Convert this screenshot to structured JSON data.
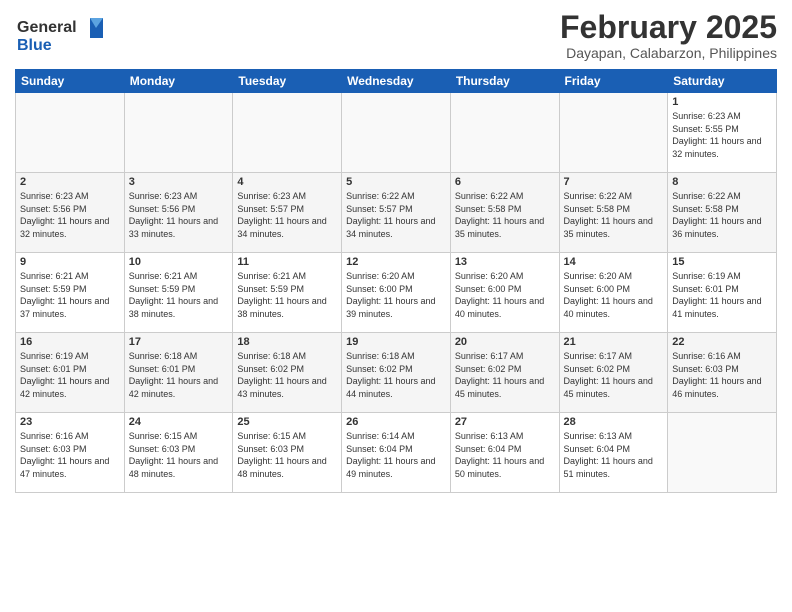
{
  "logo": {
    "general": "General",
    "blue": "Blue"
  },
  "title": "February 2025",
  "subtitle": "Dayapan, Calabarzon, Philippines",
  "weekdays": [
    "Sunday",
    "Monday",
    "Tuesday",
    "Wednesday",
    "Thursday",
    "Friday",
    "Saturday"
  ],
  "weeks": [
    [
      {
        "day": "",
        "info": ""
      },
      {
        "day": "",
        "info": ""
      },
      {
        "day": "",
        "info": ""
      },
      {
        "day": "",
        "info": ""
      },
      {
        "day": "",
        "info": ""
      },
      {
        "day": "",
        "info": ""
      },
      {
        "day": "1",
        "info": "Sunrise: 6:23 AM\nSunset: 5:55 PM\nDaylight: 11 hours and 32 minutes."
      }
    ],
    [
      {
        "day": "2",
        "info": "Sunrise: 6:23 AM\nSunset: 5:56 PM\nDaylight: 11 hours and 32 minutes."
      },
      {
        "day": "3",
        "info": "Sunrise: 6:23 AM\nSunset: 5:56 PM\nDaylight: 11 hours and 33 minutes."
      },
      {
        "day": "4",
        "info": "Sunrise: 6:23 AM\nSunset: 5:57 PM\nDaylight: 11 hours and 34 minutes."
      },
      {
        "day": "5",
        "info": "Sunrise: 6:22 AM\nSunset: 5:57 PM\nDaylight: 11 hours and 34 minutes."
      },
      {
        "day": "6",
        "info": "Sunrise: 6:22 AM\nSunset: 5:58 PM\nDaylight: 11 hours and 35 minutes."
      },
      {
        "day": "7",
        "info": "Sunrise: 6:22 AM\nSunset: 5:58 PM\nDaylight: 11 hours and 35 minutes."
      },
      {
        "day": "8",
        "info": "Sunrise: 6:22 AM\nSunset: 5:58 PM\nDaylight: 11 hours and 36 minutes."
      }
    ],
    [
      {
        "day": "9",
        "info": "Sunrise: 6:21 AM\nSunset: 5:59 PM\nDaylight: 11 hours and 37 minutes."
      },
      {
        "day": "10",
        "info": "Sunrise: 6:21 AM\nSunset: 5:59 PM\nDaylight: 11 hours and 38 minutes."
      },
      {
        "day": "11",
        "info": "Sunrise: 6:21 AM\nSunset: 5:59 PM\nDaylight: 11 hours and 38 minutes."
      },
      {
        "day": "12",
        "info": "Sunrise: 6:20 AM\nSunset: 6:00 PM\nDaylight: 11 hours and 39 minutes."
      },
      {
        "day": "13",
        "info": "Sunrise: 6:20 AM\nSunset: 6:00 PM\nDaylight: 11 hours and 40 minutes."
      },
      {
        "day": "14",
        "info": "Sunrise: 6:20 AM\nSunset: 6:00 PM\nDaylight: 11 hours and 40 minutes."
      },
      {
        "day": "15",
        "info": "Sunrise: 6:19 AM\nSunset: 6:01 PM\nDaylight: 11 hours and 41 minutes."
      }
    ],
    [
      {
        "day": "16",
        "info": "Sunrise: 6:19 AM\nSunset: 6:01 PM\nDaylight: 11 hours and 42 minutes."
      },
      {
        "day": "17",
        "info": "Sunrise: 6:18 AM\nSunset: 6:01 PM\nDaylight: 11 hours and 42 minutes."
      },
      {
        "day": "18",
        "info": "Sunrise: 6:18 AM\nSunset: 6:02 PM\nDaylight: 11 hours and 43 minutes."
      },
      {
        "day": "19",
        "info": "Sunrise: 6:18 AM\nSunset: 6:02 PM\nDaylight: 11 hours and 44 minutes."
      },
      {
        "day": "20",
        "info": "Sunrise: 6:17 AM\nSunset: 6:02 PM\nDaylight: 11 hours and 45 minutes."
      },
      {
        "day": "21",
        "info": "Sunrise: 6:17 AM\nSunset: 6:02 PM\nDaylight: 11 hours and 45 minutes."
      },
      {
        "day": "22",
        "info": "Sunrise: 6:16 AM\nSunset: 6:03 PM\nDaylight: 11 hours and 46 minutes."
      }
    ],
    [
      {
        "day": "23",
        "info": "Sunrise: 6:16 AM\nSunset: 6:03 PM\nDaylight: 11 hours and 47 minutes."
      },
      {
        "day": "24",
        "info": "Sunrise: 6:15 AM\nSunset: 6:03 PM\nDaylight: 11 hours and 48 minutes."
      },
      {
        "day": "25",
        "info": "Sunrise: 6:15 AM\nSunset: 6:03 PM\nDaylight: 11 hours and 48 minutes."
      },
      {
        "day": "26",
        "info": "Sunrise: 6:14 AM\nSunset: 6:04 PM\nDaylight: 11 hours and 49 minutes."
      },
      {
        "day": "27",
        "info": "Sunrise: 6:13 AM\nSunset: 6:04 PM\nDaylight: 11 hours and 50 minutes."
      },
      {
        "day": "28",
        "info": "Sunrise: 6:13 AM\nSunset: 6:04 PM\nDaylight: 11 hours and 51 minutes."
      },
      {
        "day": "",
        "info": ""
      }
    ]
  ]
}
